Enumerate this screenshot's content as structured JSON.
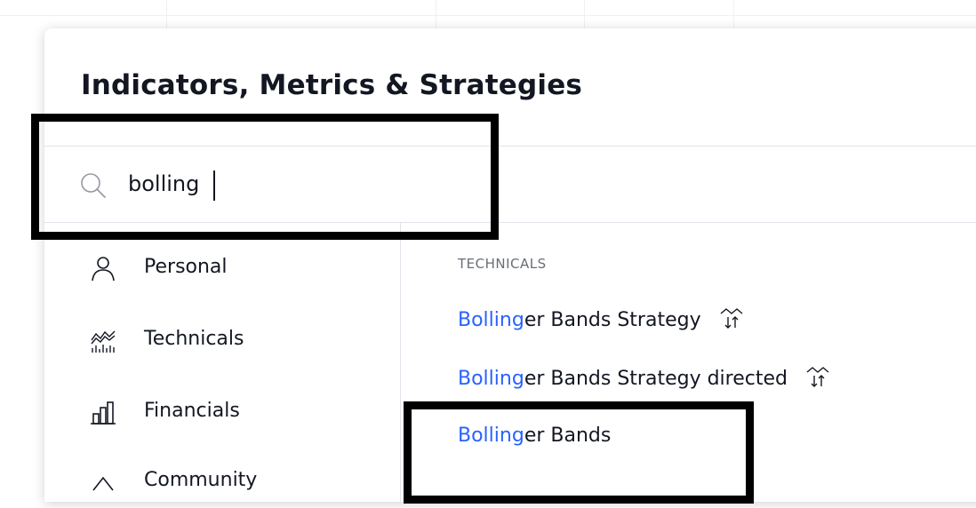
{
  "dialog": {
    "title": "Indicators, Metrics & Strategies"
  },
  "search": {
    "value": "bolling",
    "icon": "search-icon"
  },
  "sidebar": {
    "items": [
      {
        "label": "Personal",
        "icon": "user-icon"
      },
      {
        "label": "Technicals",
        "icon": "technicals-icon"
      },
      {
        "label": "Financials",
        "icon": "financials-icon"
      },
      {
        "label": "Community",
        "icon": "community-icon"
      }
    ]
  },
  "results": {
    "section_header": "TECHNICALS",
    "items": [
      {
        "match": "Bolling",
        "rest": "er Bands Strategy",
        "strategy_icon": true
      },
      {
        "match": "Bolling",
        "rest": "er Bands Strategy directed",
        "strategy_icon": true
      },
      {
        "match": "Bolling",
        "rest": "er Bands",
        "strategy_icon": false
      }
    ]
  },
  "colors": {
    "match": "#2962ff",
    "text": "#131722",
    "annotation_box": "#000000"
  }
}
